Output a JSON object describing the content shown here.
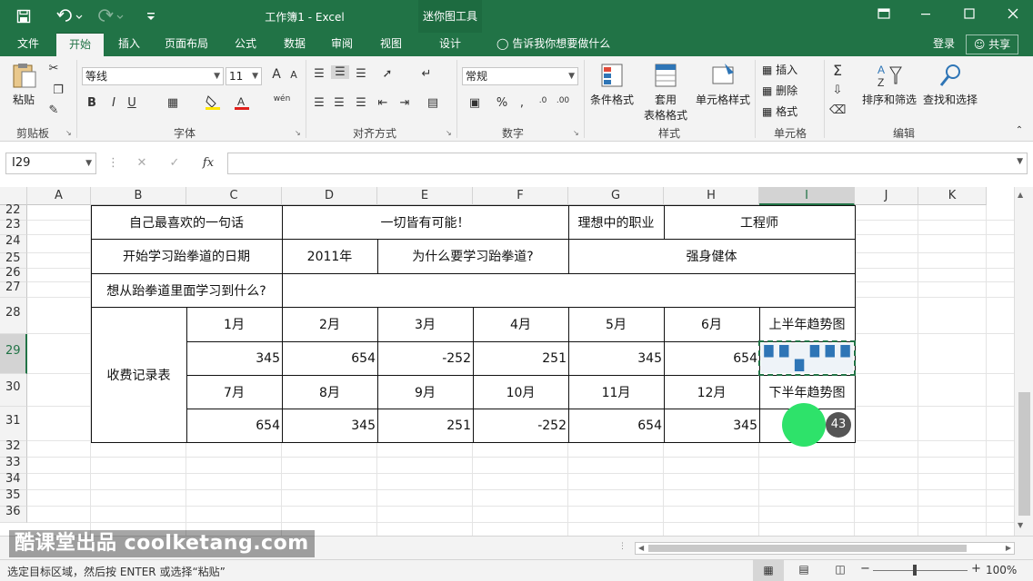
{
  "app": {
    "title": "工作簿1 - Excel",
    "contextual_tab": "迷你图工具",
    "colors": {
      "accent": "#217346",
      "selection": "#217346",
      "sparkline": "#2e75b6",
      "cursor": "#2ee26a"
    }
  },
  "tabs": [
    "文件",
    "开始",
    "插入",
    "页面布局",
    "公式",
    "数据",
    "审阅",
    "视图",
    "设计"
  ],
  "active_tab": "开始",
  "tell_me": "告诉我你想要做什么",
  "account": {
    "login": "登录",
    "share": "共享"
  },
  "ribbon": {
    "clipboard": {
      "paste": "粘贴",
      "label": "剪贴板"
    },
    "font": {
      "name": "等线",
      "size": "11",
      "label": "字体",
      "bold": "B",
      "italic": "I",
      "underline": "U",
      "font_grow": "A",
      "font_shrink": "A",
      "phonetic": "wén"
    },
    "alignment": {
      "label": "对齐方式"
    },
    "number": {
      "format": "常规",
      "label": "数字"
    },
    "styles": {
      "conditional": "条件格式",
      "table_format_line1": "套用",
      "table_format_line2": "表格格式",
      "cell_styles": "单元格样式",
      "label": "样式"
    },
    "cells": {
      "insert": "插入",
      "delete": "删除",
      "format": "格式",
      "label": "单元格"
    },
    "editing": {
      "sort_filter": "排序和筛选",
      "find_select": "查找和选择",
      "label": "编辑"
    }
  },
  "formula_bar": {
    "name_box": "I29",
    "fx": "fx",
    "value": ""
  },
  "columns": [
    "A",
    "B",
    "C",
    "D",
    "E",
    "F",
    "G",
    "H",
    "I",
    "J",
    "K"
  ],
  "rows": [
    "22",
    "23",
    "24",
    "25",
    "26",
    "27",
    "28",
    "29",
    "30",
    "31",
    "32",
    "33",
    "34",
    "35",
    "36"
  ],
  "table": {
    "fav_sentence_label": "自己最喜欢的一句话",
    "fav_sentence_value": "一切皆有可能！",
    "dream_job_label": "理想中的职业",
    "dream_job_value": "工程师",
    "start_date_label": "开始学习跆拳道的日期",
    "start_date_value": "2011年",
    "why_label": "为什么要学习跆拳道?",
    "why_value": "强身健体",
    "learn_what_label": "想从跆拳道里面学习到什么?",
    "fee_label": "收费记录表",
    "h1_months": [
      "1月",
      "2月",
      "3月",
      "4月",
      "5月",
      "6月"
    ],
    "h1_values": [
      "345",
      "654",
      "-252",
      "251",
      "345",
      "654"
    ],
    "h1_trend_label": "上半年趋势图",
    "h2_months": [
      "7月",
      "8月",
      "9月",
      "10月",
      "11月",
      "12月"
    ],
    "h2_values": [
      "654",
      "345",
      "251",
      "-252",
      "654",
      "345"
    ],
    "h2_trend_label": "下半年趋势图"
  },
  "sparkline_h1": {
    "values": [
      345,
      654,
      -252,
      251,
      345,
      654
    ]
  },
  "cursor_badge": "43",
  "status": {
    "message": "选定目标区域，然后按 ENTER 或选择“粘贴”",
    "zoom": "100%"
  },
  "watermark": "酷课堂出品 coolketang.com"
}
